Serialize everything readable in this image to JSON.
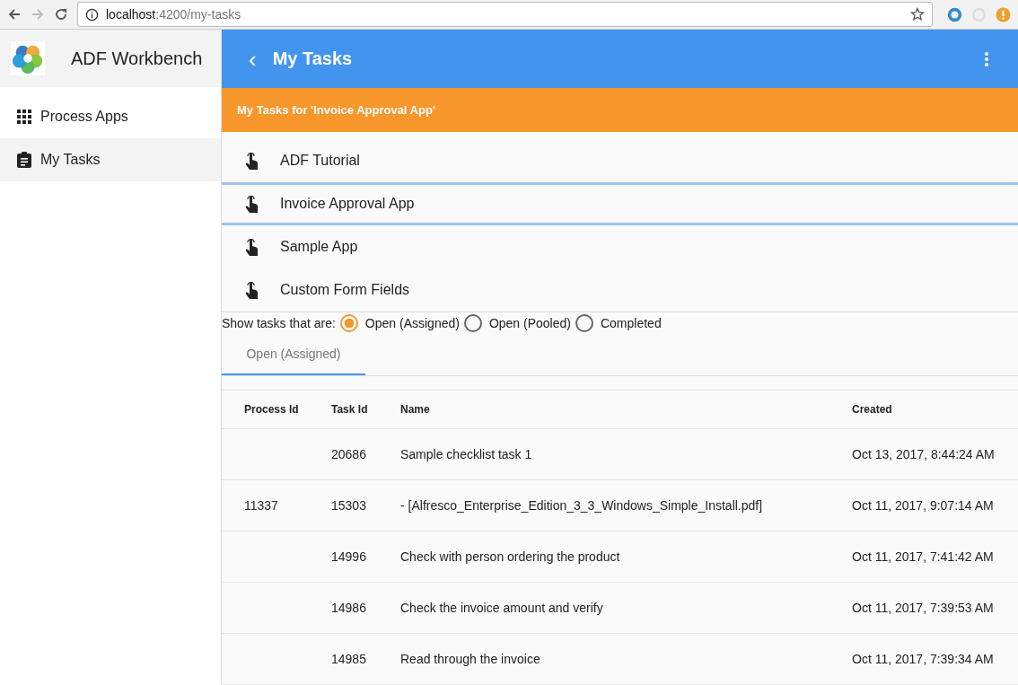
{
  "browser": {
    "url_host": "localhost",
    "url_path": ":4200/my-tasks"
  },
  "sidebar": {
    "title": "ADF Workbench",
    "items": [
      {
        "label": "Process Apps",
        "selected": false
      },
      {
        "label": "My Tasks",
        "selected": true
      }
    ]
  },
  "toolbar": {
    "back": "‹",
    "title": "My Tasks"
  },
  "banner": "My Tasks for 'Invoice Approval App'",
  "apps": [
    {
      "name": "ADF Tutorial",
      "selected": false
    },
    {
      "name": "Invoice Approval App",
      "selected": true
    },
    {
      "name": "Sample App",
      "selected": false
    },
    {
      "name": "Custom Form Fields",
      "selected": false
    }
  ],
  "filter": {
    "label": "Show tasks that are:",
    "options": [
      {
        "label": "Open (Assigned)",
        "selected": true
      },
      {
        "label": "Open (Pooled)",
        "selected": false
      },
      {
        "label": "Completed",
        "selected": false
      }
    ]
  },
  "tabs": [
    {
      "label": "Open (Assigned)",
      "selected": true
    }
  ],
  "table": {
    "columns": [
      "Process Id",
      "Task Id",
      "Name",
      "Created"
    ],
    "rows": [
      [
        "",
        "20686",
        "Sample checklist task 1",
        "Oct 13, 2017, 8:44:24 AM"
      ],
      [
        "11337",
        "15303",
        "- [Alfresco_Enterprise_Edition_3_3_Windows_Simple_Install.pdf]",
        "Oct 11, 2017, 9:07:14 AM"
      ],
      [
        "",
        "14996",
        "Check with person ordering the product",
        "Oct 11, 2017, 7:41:42 AM"
      ],
      [
        "",
        "14986",
        "Check the invoice amount and verify",
        "Oct 11, 2017, 7:39:53 AM"
      ],
      [
        "",
        "14985",
        "Read through the invoice",
        "Oct 11, 2017, 7:39:34 AM"
      ]
    ]
  }
}
